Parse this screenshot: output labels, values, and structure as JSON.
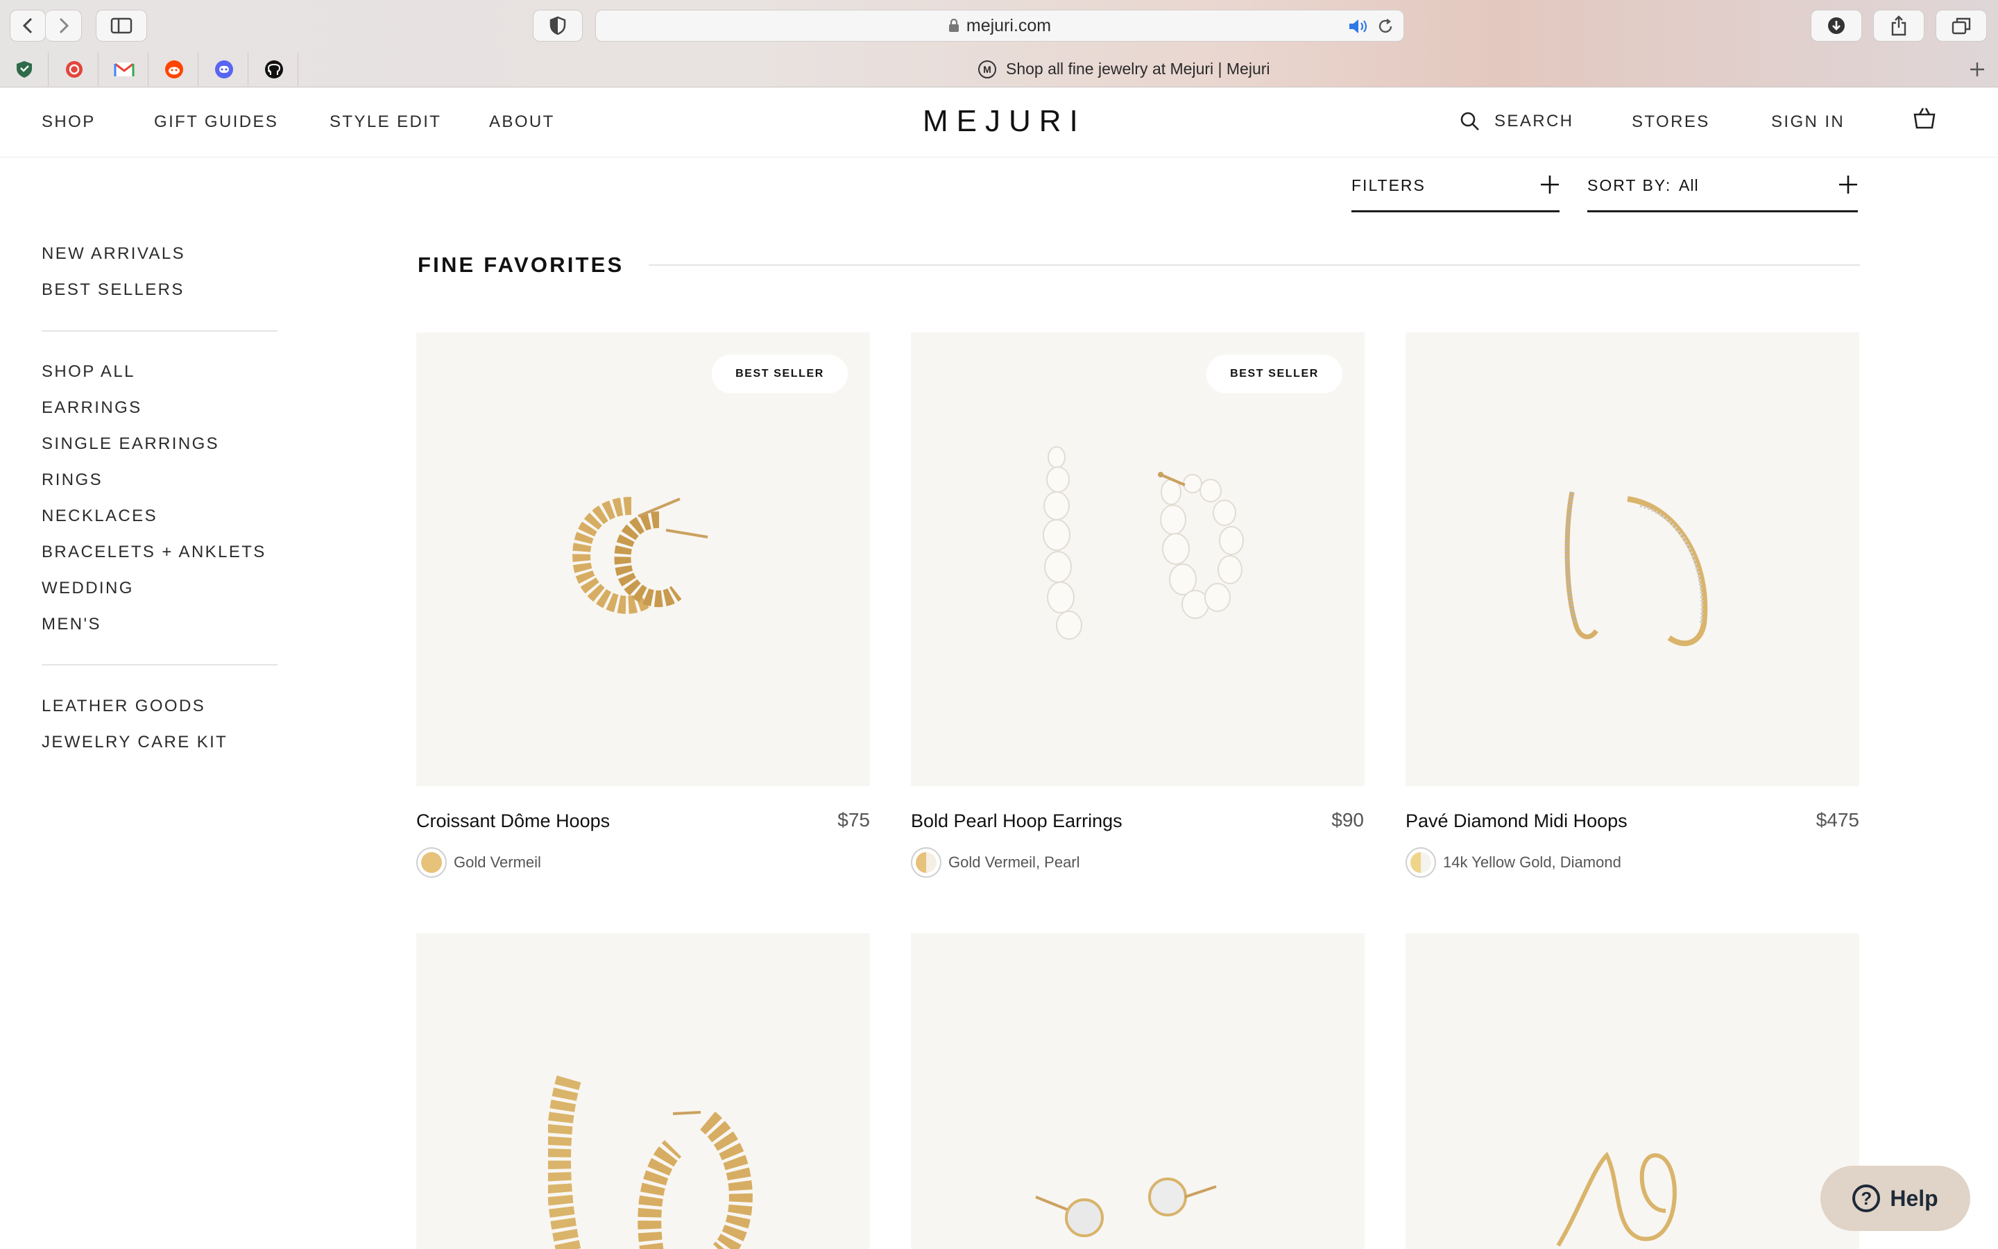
{
  "browser": {
    "url": "mejuri.com",
    "tab_title": "Shop all fine jewelry at Mejuri | Mejuri",
    "tab_logo_letter": "M",
    "favorites": [
      "shield-favicon",
      "redbubble-favicon",
      "gmail-favicon",
      "reddit-favicon",
      "discord-favicon",
      "github-favicon"
    ]
  },
  "header": {
    "brand": "MEJURI",
    "nav_left": [
      "SHOP",
      "GIFT GUIDES",
      "STYLE EDIT",
      "ABOUT"
    ],
    "search_label": "SEARCH",
    "stores_label": "STORES",
    "sign_in_label": "SIGN IN"
  },
  "toolbar": {
    "filters_label": "FILTERS",
    "sort_label": "SORT BY:",
    "sort_value": "All"
  },
  "sidebar": {
    "group1": [
      "NEW ARRIVALS",
      "BEST SELLERS"
    ],
    "group2": [
      "SHOP ALL",
      "EARRINGS",
      "SINGLE EARRINGS",
      "RINGS",
      "NECKLACES",
      "BRACELETS + ANKLETS",
      "WEDDING",
      "MEN'S"
    ],
    "group3": [
      "LEATHER GOODS",
      "JEWELRY CARE KIT"
    ]
  },
  "section_title": "FINE FAVORITES",
  "products": [
    {
      "name": "Croissant Dôme Hoops",
      "price": "$75",
      "material": "Gold Vermeil",
      "badge": "BEST SELLER",
      "swatch": "#e6c27a"
    },
    {
      "name": "Bold Pearl Hoop Earrings",
      "price": "$90",
      "material": "Gold Vermeil, Pearl",
      "badge": "BEST SELLER",
      "swatch": "#e6c27a"
    },
    {
      "name": "Pavé Diamond Midi Hoops",
      "price": "$475",
      "material": "14k Yellow Gold, Diamond",
      "badge": "",
      "swatch": "#efd58a"
    }
  ],
  "help_label": "Help",
  "colors": {
    "accent_text": "#111111",
    "card_bg": "#f8f6f2",
    "help_bg": "#e0d3c7",
    "gold": "#d9b46a"
  }
}
